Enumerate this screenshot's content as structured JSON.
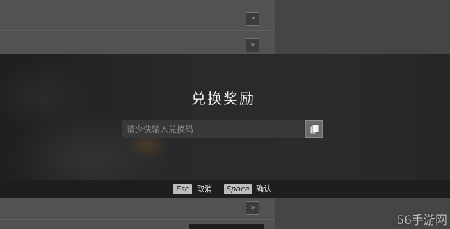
{
  "background": {
    "expand_glyph": "»",
    "rows": [
      {
        "expand_label": "»"
      },
      {
        "expand_label": "»"
      },
      {
        "expand_label": "»"
      }
    ]
  },
  "modal": {
    "title": "兑换奖励",
    "code_input": {
      "value": "",
      "placeholder": "请少侠输入兑换码"
    },
    "paste_button_icon": "paste-icon"
  },
  "hints": {
    "esc_key": "Esc",
    "esc_action": "取消",
    "space_key": "Space",
    "space_action": "确认"
  },
  "watermark": "56手游网",
  "colors": {
    "modal_bg": "#2a2a2c",
    "hint_bar_bg": "#1e1e20",
    "key_bg": "#bdbdbf",
    "title_text": "#f2f2f2"
  }
}
